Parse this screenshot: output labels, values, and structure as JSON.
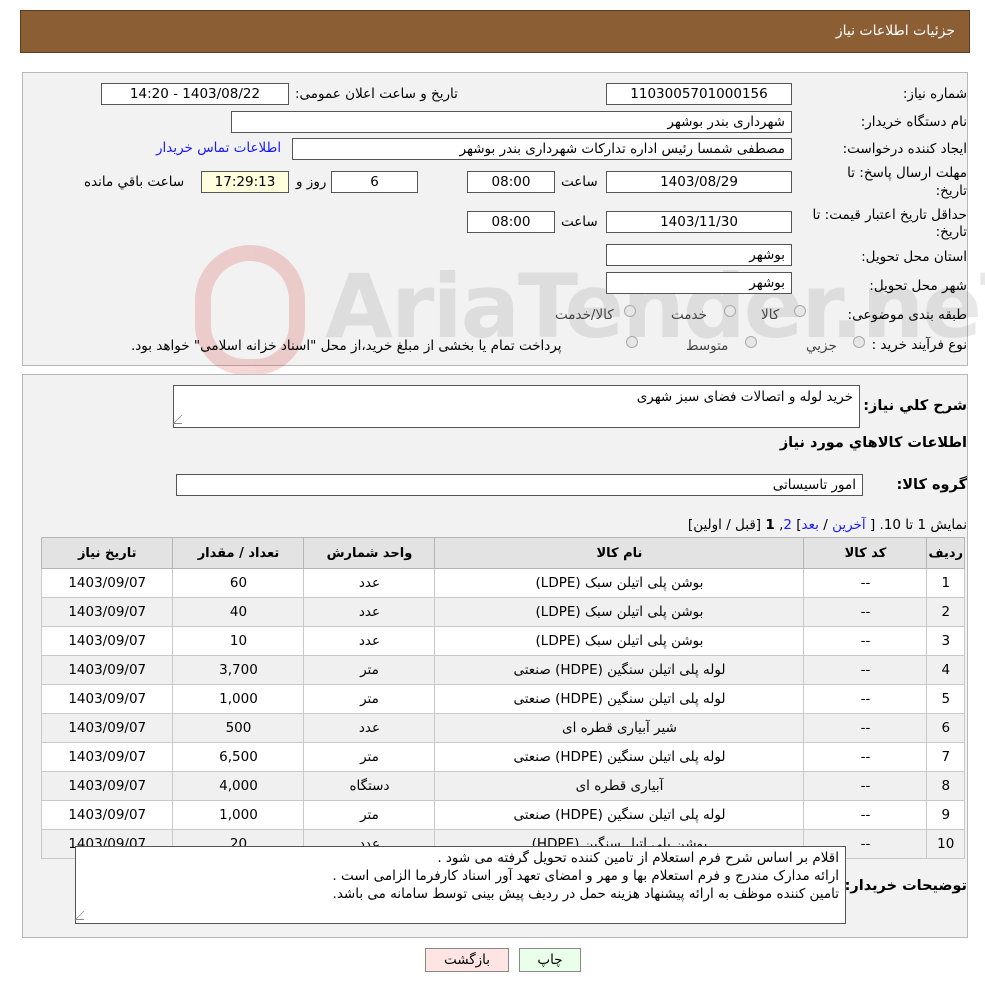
{
  "header": {
    "title": "جزئیات اطلاعات نیاز"
  },
  "form": {
    "need_number_label": "شماره نیاز:",
    "need_number": "1103005701000156",
    "announce_label": "تاریخ و ساعت اعلان عمومی:",
    "announce_value": "1403/08/22 - 14:20",
    "buyer_org_label": "نام دستگاه خریدار:",
    "buyer_org": "شهرداری بندر بوشهر",
    "requester_label": "ایجاد کننده درخواست:",
    "requester": "مصطفی شمسا رئیس اداره تداركات  شهرداری بندر بوشهر",
    "contact_link": "اطلاعات تماس خریدار",
    "deadline_label": "مهلت ارسال پاسخ: تا",
    "deadline_label2": "تاریخ:",
    "deadline_date": "1403/08/29",
    "time_label": "ساعت",
    "deadline_time": "08:00",
    "days": "6",
    "days_label": "روز و",
    "remaining_time": "17:29:13",
    "remaining_label": "ساعت باقي مانده",
    "validity_label": "حداقل تاریخ اعتبار قیمت: تا",
    "validity_label2": "تاریخ:",
    "validity_date": "1403/11/30",
    "validity_time": "08:00",
    "province_label": "استان محل تحویل:",
    "province": "بوشهر",
    "city_label": "شهر محل تحویل:",
    "city": "بوشهر",
    "category_label": "طبقه بندی موضوعی:",
    "category_options": [
      "کالا",
      "خدمت",
      "کالا/خدمت"
    ],
    "process_label": "نوع فرآیند خرید :",
    "process_options": [
      "جزيي",
      "متوسط"
    ],
    "process_note": "پرداخت تمام یا بخشی از مبلغ خرید،از محل \"اسناد خزانه اسلامی\" خواهد بود."
  },
  "summary": {
    "desc_label": "شرح كلي نياز:",
    "desc_value": "خرید لوله و اتصالات فضای سبز شهری",
    "goods_info_title": "اطلاعات كالاهاي مورد نياز",
    "group_label": "گروه كالا:",
    "group_value": "امور تاسیساتی",
    "pagination": {
      "show": "نمایش 1 تا 10.",
      "open": "[",
      "last": "آخرین",
      "sep1": "/",
      "next": "بعد",
      "close": "]",
      "p2": "2",
      "comma": ",",
      "p1": "1",
      "rest": "[قبل / اولین]"
    }
  },
  "table": {
    "headers": [
      "رديف",
      "کد کالا",
      "نام کالا",
      "واحد شمارش",
      "تعداد / مقدار",
      "تاریخ نیاز"
    ],
    "rows": [
      [
        "1",
        "--",
        "بوشن پلی اتیلن سبک (LDPE)",
        "عدد",
        "60",
        "1403/09/07"
      ],
      [
        "2",
        "--",
        "بوشن پلی اتیلن سبک (LDPE)",
        "عدد",
        "40",
        "1403/09/07"
      ],
      [
        "3",
        "--",
        "بوشن پلی اتیلن سبک (LDPE)",
        "عدد",
        "10",
        "1403/09/07"
      ],
      [
        "4",
        "--",
        "لوله پلی اتیلن سنگین (HDPE) صنعتی",
        "متر",
        "3,700",
        "1403/09/07"
      ],
      [
        "5",
        "--",
        "لوله پلی اتیلن سنگین (HDPE) صنعتی",
        "متر",
        "1,000",
        "1403/09/07"
      ],
      [
        "6",
        "--",
        "شیر آبیاری قطره ای",
        "عدد",
        "500",
        "1403/09/07"
      ],
      [
        "7",
        "--",
        "لوله پلی اتیلن سنگین (HDPE) صنعتی",
        "متر",
        "6,500",
        "1403/09/07"
      ],
      [
        "8",
        "--",
        "آبیاری قطره ای",
        "دستگاه",
        "4,000",
        "1403/09/07"
      ],
      [
        "9",
        "--",
        "لوله پلی اتیلن سنگین (HDPE) صنعتی",
        "متر",
        "1,000",
        "1403/09/07"
      ],
      [
        "10",
        "--",
        "بوشن پلی اتیل سنگین (HDPE)",
        "عدد",
        "20",
        "1403/09/07"
      ]
    ]
  },
  "notes": {
    "label": "توضیحات خریدار:",
    "lines": [
      "اقلام بر اساس شرح فرم استعلام از تامین کننده تحویل گرفته می شود .",
      "ارائه مدارک مندرج و فرم استعلام بها و مهر و امضای تعهد آور اسناد کارفرما الزامی است .",
      "تامین  کننده موظف به ارائه پیشنهاد هزینه حمل در ردیف پیش بینی توسط سامانه می باشد."
    ]
  },
  "buttons": {
    "print": "چاپ",
    "back": "بازگشت"
  },
  "watermark": {
    "text": "AriaTender.neT"
  }
}
